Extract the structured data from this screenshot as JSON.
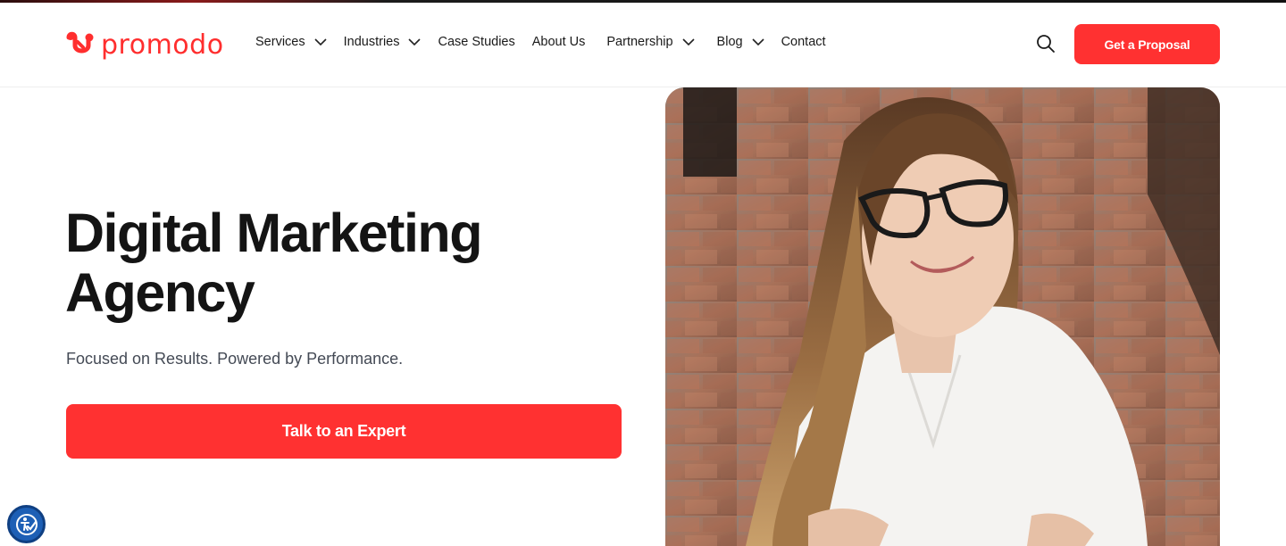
{
  "brand": {
    "name": "promodo",
    "accent_color": "#ff3131"
  },
  "nav": {
    "items": [
      {
        "label": "Services",
        "has_dropdown": true
      },
      {
        "label": "Industries",
        "has_dropdown": true
      },
      {
        "label": "Case Studies",
        "has_dropdown": false
      },
      {
        "label": "About Us",
        "has_dropdown": false
      },
      {
        "label": "Partnership",
        "has_dropdown": true
      },
      {
        "label": "Blog",
        "has_dropdown": true
      },
      {
        "label": "Contact",
        "has_dropdown": false
      }
    ],
    "search_icon": "search-icon",
    "cta_label": "Get a Proposal"
  },
  "hero": {
    "title_line1": "Digital Marketing",
    "title_line2": "Agency",
    "subtitle": "Focused on Results. Powered by Performance.",
    "cta_label": "Talk to an Expert",
    "photo_icon": "person-photo"
  },
  "widgets": {
    "accessibility_icon": "accessibility-icon"
  }
}
